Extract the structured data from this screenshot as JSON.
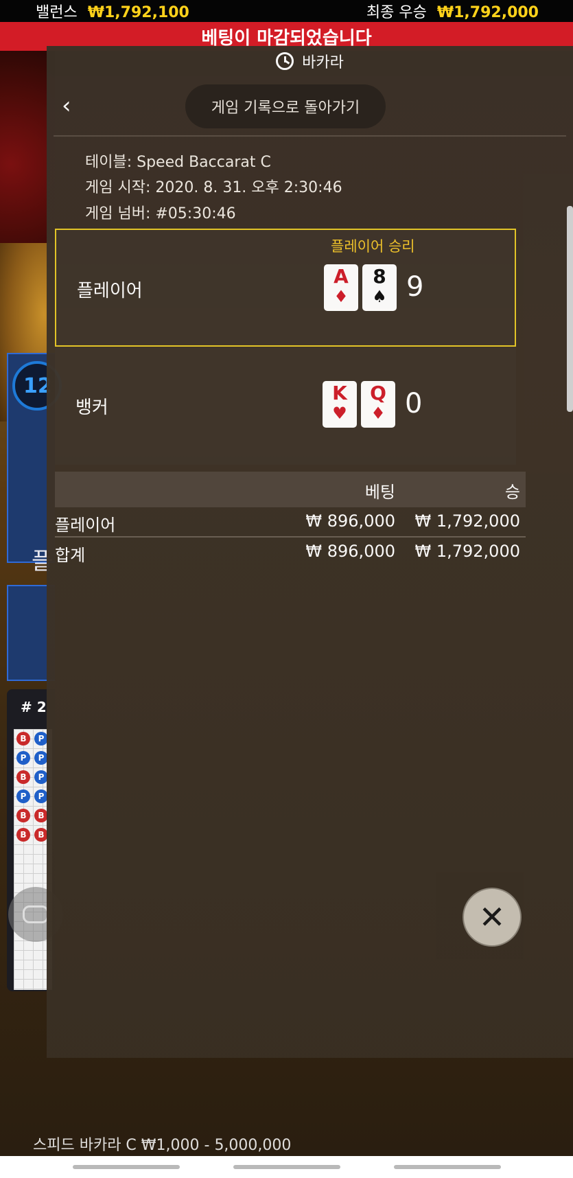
{
  "topbar": {
    "balance_label": "밸런스",
    "balance_value": "₩1,792,100",
    "final_win_label": "최종 우승",
    "final_win_value": "₩1,792,000"
  },
  "banner": {
    "text": "베팅이 마감되었습니다"
  },
  "background": {
    "timer_text": "12",
    "letter": "플",
    "road_hash": "# 2",
    "beads": [
      "B",
      "P",
      "P",
      "P",
      "B",
      "P",
      "P",
      "P",
      "B",
      "B",
      "B",
      "B"
    ],
    "table_limit": "스피드 바카라 C ₩1,000 - 5,000,000"
  },
  "panel": {
    "header": {
      "title": "바카라",
      "icon": "history-icon"
    },
    "back_button": {
      "label": "게임 기록으로 돌아가기",
      "icon": "chevron-left-icon"
    },
    "meta": {
      "table": "테이블: Speed Baccarat C",
      "started": "게임 시작: 2020. 8. 31. 오후 2:30:46",
      "number": "게임 넘버: #05:30:46"
    },
    "player": {
      "name": "플레이어",
      "win_label": "플레이어 승리",
      "cards": [
        {
          "rank": "A",
          "suit": "♦",
          "color": "red"
        },
        {
          "rank": "8",
          "suit": "♠",
          "color": "black"
        }
      ],
      "score": "9"
    },
    "banker": {
      "name": "뱅커",
      "cards": [
        {
          "rank": "K",
          "suit": "♥",
          "color": "red"
        },
        {
          "rank": "Q",
          "suit": "♦",
          "color": "red"
        }
      ],
      "score": "0"
    },
    "bets": {
      "headers": {
        "bet": "베팅",
        "win": "승"
      },
      "rows": [
        {
          "name": "플레이어",
          "bet": "₩ 896,000",
          "win": "₩ 1,792,000"
        },
        {
          "name": "합계",
          "bet": "₩ 896,000",
          "win": "₩ 1,792,000"
        }
      ]
    },
    "close_label": "✕"
  },
  "colors": {
    "accent_yellow": "#ffd21a",
    "banner_red": "#d31c26",
    "win_border": "#e7c928",
    "card_red": "#d01e2b"
  }
}
